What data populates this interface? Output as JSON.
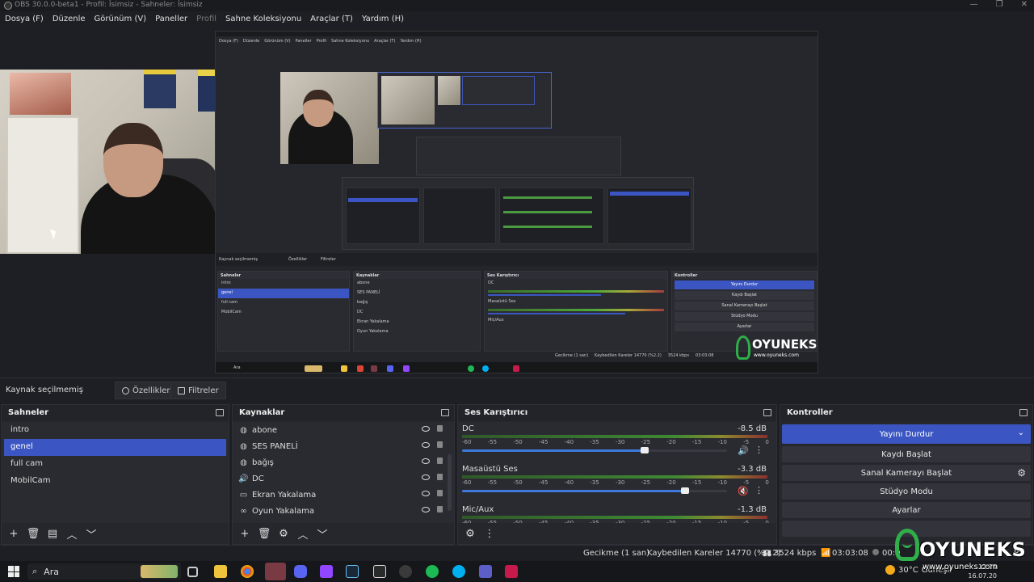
{
  "window": {
    "title": "OBS 30.0.0-beta1 - Profil: İsimsiz - Sahneler: İsimsiz"
  },
  "menu": [
    {
      "label": "Dosya (F)",
      "enabled": true
    },
    {
      "label": "Düzenle",
      "enabled": true
    },
    {
      "label": "Görünüm (V)",
      "enabled": true
    },
    {
      "label": "Paneller",
      "enabled": true
    },
    {
      "label": "Profil",
      "enabled": false
    },
    {
      "label": "Sahne Koleksiyonu",
      "enabled": true
    },
    {
      "label": "Araçlar (T)",
      "enabled": true
    },
    {
      "label": "Yardım (H)",
      "enabled": true
    }
  ],
  "source_toolbar": {
    "label": "Kaynak seçilmemiş",
    "properties": "Özellikler",
    "filters": "Filtreler"
  },
  "scenes": {
    "title": "Sahneler",
    "items": [
      {
        "label": "intro",
        "selected": false
      },
      {
        "label": "genel",
        "selected": true
      },
      {
        "label": "full cam",
        "selected": false
      },
      {
        "label": "MobilCam",
        "selected": false
      }
    ]
  },
  "sources": {
    "title": "Kaynaklar",
    "items": [
      {
        "label": "abone",
        "icon": "browser-icon"
      },
      {
        "label": "SES PANELİ",
        "icon": "browser-icon"
      },
      {
        "label": "bağış",
        "icon": "browser-icon"
      },
      {
        "label": "DC",
        "icon": "speaker-icon"
      },
      {
        "label": "Ekran Yakalama",
        "icon": "monitor-icon"
      },
      {
        "label": "Oyun Yakalama",
        "icon": "gamepad-icon"
      }
    ]
  },
  "mixer": {
    "title": "Ses Karıştırıcı",
    "ticks": [
      "-60",
      "-55",
      "-50",
      "-45",
      "-40",
      "-35",
      "-30",
      "-25",
      "-20",
      "-15",
      "-10",
      "-5",
      "0"
    ],
    "channels": [
      {
        "name": "DC",
        "db": "-8.5 dB",
        "level": 0.69,
        "muted": false
      },
      {
        "name": "Masaüstü Ses",
        "db": "-3.3 dB",
        "level": 0.84,
        "muted": true
      },
      {
        "name": "Mic/Aux",
        "db": "-1.3 dB",
        "level": 0.9,
        "muted": false
      }
    ]
  },
  "controls": {
    "title": "Kontroller",
    "stop_stream": "Yayını Durdur",
    "start_record": "Kaydı Başlat",
    "virtual_cam": "Sanal Kamerayı Başlat",
    "studio_mode": "Stüdyo Modu",
    "settings": "Ayarlar"
  },
  "status": {
    "delay": "Gecikme (1 san)",
    "dropped": "Kaybedilen Kareler 14770 (%2.2)",
    "bitrate": "3524 kbps",
    "stream_time": "03:03:08",
    "record_time": "00:0",
    "fps": "PS"
  },
  "taskbar": {
    "search": "Ara",
    "weather": "30°C",
    "weather_desc": "Güneşli",
    "time": "12:20",
    "date": "16.07.20"
  },
  "watermark": {
    "name": "OYUNEKS",
    "url": "www.oyuneks.com"
  },
  "colors": {
    "accent": "#3b56c2",
    "panel": "#2a2b31",
    "bg": "#1e1f24",
    "logo_green": "#2fae4a"
  }
}
